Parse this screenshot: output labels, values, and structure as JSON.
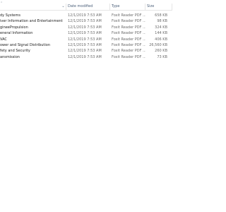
{
  "columns": {
    "name_label": "",
    "date_label": "Date modified",
    "type_label": "Type",
    "size_label": "Size"
  },
  "files": [
    {
      "name": "dy Systems",
      "date": "12/1/2019 7:53 AM",
      "type": "Foxit Reader PDF ...",
      "size": "658 KB"
    },
    {
      "name": "iver Information and Entertainment",
      "date": "12/1/2019 7:53 AM",
      "type": "Foxit Reader PDF ...",
      "size": "98 KB"
    },
    {
      "name": "gineePropulsion",
      "date": "12/1/2019 7:53 AM",
      "type": "Foxit Reader PDF ...",
      "size": "324 KB"
    },
    {
      "name": "eneral Information",
      "date": "12/1/2019 7:53 AM",
      "type": "Foxit Reader PDF ...",
      "size": "144 KB"
    },
    {
      "name": "VAC",
      "date": "12/1/2019 7:53 AM",
      "type": "Foxit Reader PDF ...",
      "size": "406 KB"
    },
    {
      "name": "ower and Signal Distribution",
      "date": "12/1/2019 7:53 AM",
      "type": "Foxit Reader PDF ...",
      "size": "26,560 KB"
    },
    {
      "name": "fety and Security",
      "date": "12/1/2019 7:53 AM",
      "type": "Foxit Reader PDF ...",
      "size": "260 KB"
    },
    {
      "name": "ansmission",
      "date": "12/1/2019 7:53 AM",
      "type": "Foxit Reader PDF ...",
      "size": "73 KB"
    }
  ]
}
